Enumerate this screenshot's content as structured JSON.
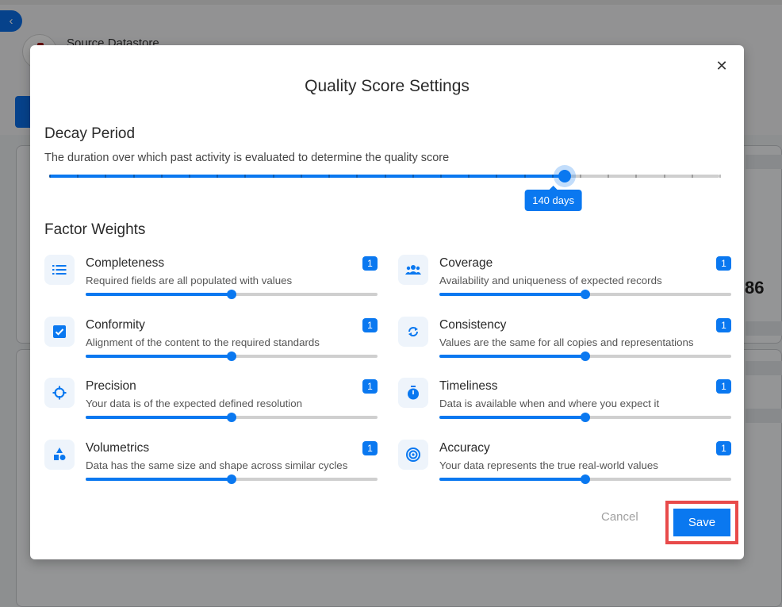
{
  "background": {
    "back_icon": "chevron-left-icon",
    "back_glyph": "‹",
    "source_label": "Source Datastore",
    "partial_value": "86"
  },
  "modal": {
    "title": "Quality Score Settings",
    "close_glyph": "✕",
    "decay": {
      "title": "Decay Period",
      "description": "The duration over which past activity is evaluated to determine the quality score",
      "value_days": 140,
      "min_days": 7,
      "max_days": 180,
      "tick_count": 25,
      "value_label": "140 days"
    },
    "weights": {
      "title": "Factor Weights",
      "min": 0,
      "max": 2,
      "factors": [
        {
          "name": "Completeness",
          "description": "Required fields are all populated with values",
          "value": 1,
          "badge": "1",
          "icon": "list-icon"
        },
        {
          "name": "Coverage",
          "description": "Availability and uniqueness of expected records",
          "value": 1,
          "badge": "1",
          "icon": "users-icon"
        },
        {
          "name": "Conformity",
          "description": "Alignment of the content to the required standards",
          "value": 1,
          "badge": "1",
          "icon": "checkbox-icon"
        },
        {
          "name": "Consistency",
          "description": "Values are the same for all copies and representations",
          "value": 1,
          "badge": "1",
          "icon": "sync-icon"
        },
        {
          "name": "Precision",
          "description": "Your data is of the expected defined resolution",
          "value": 1,
          "badge": "1",
          "icon": "crosshair-icon"
        },
        {
          "name": "Timeliness",
          "description": "Data is available when and where you expect it",
          "value": 1,
          "badge": "1",
          "icon": "stopwatch-icon"
        },
        {
          "name": "Volumetrics",
          "description": "Data has the same size and shape across similar cycles",
          "value": 1,
          "badge": "1",
          "icon": "shapes-icon"
        },
        {
          "name": "Accuracy",
          "description": "Your data represents the true real-world values",
          "value": 1,
          "badge": "1",
          "icon": "target-icon"
        }
      ]
    },
    "actions": {
      "cancel_label": "Cancel",
      "save_label": "Save"
    }
  },
  "colors": {
    "accent": "#0a78f0",
    "highlight": "#e84a4a"
  }
}
